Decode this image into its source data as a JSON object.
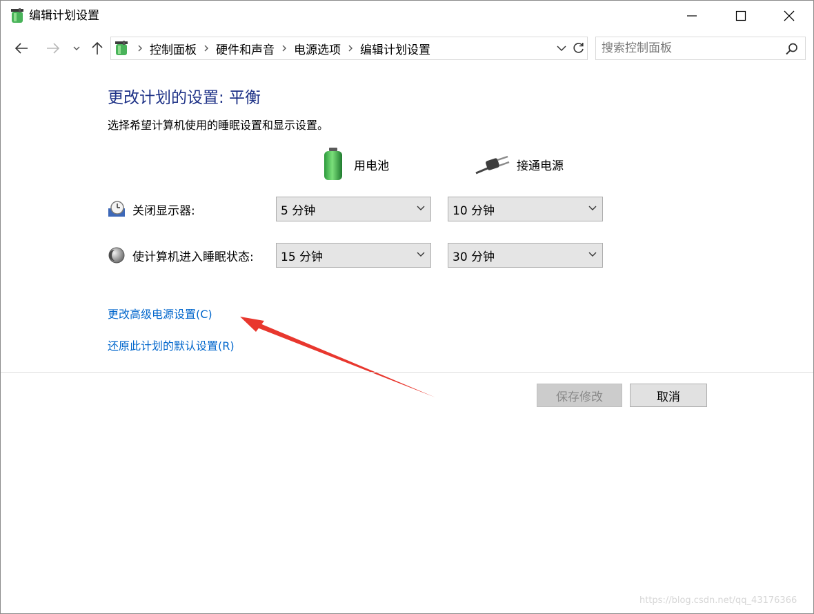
{
  "window": {
    "title": "编辑计划设置",
    "app_icon": "power-options-icon"
  },
  "navigation": {
    "breadcrumbs": [
      {
        "label": "控制面板"
      },
      {
        "label": "硬件和声音"
      },
      {
        "label": "电源选项"
      },
      {
        "label": "编辑计划设置"
      }
    ],
    "search_placeholder": "搜索控制面板"
  },
  "content": {
    "heading": "更改计划的设置: 平衡",
    "subtitle": "选择希望计算机使用的睡眠设置和显示设置。",
    "columns": {
      "battery": "用电池",
      "plugged_in": "接通电源"
    },
    "settings": [
      {
        "label": "关闭显示器:",
        "icon": "display-clock-icon",
        "battery": "5 分钟",
        "plugged_in": "10 分钟"
      },
      {
        "label": "使计算机进入睡眠状态:",
        "icon": "sleep-moon-icon",
        "battery": "15 分钟",
        "plugged_in": "30 分钟"
      }
    ],
    "links": {
      "advanced": "更改高级电源设置(C)",
      "restore": "还原此计划的默认设置(R)"
    }
  },
  "buttons": {
    "save": "保存修改",
    "cancel": "取消"
  },
  "annotation": {
    "color": "#e8372e"
  },
  "watermark": "https://blog.csdn.net/qq_43176366"
}
